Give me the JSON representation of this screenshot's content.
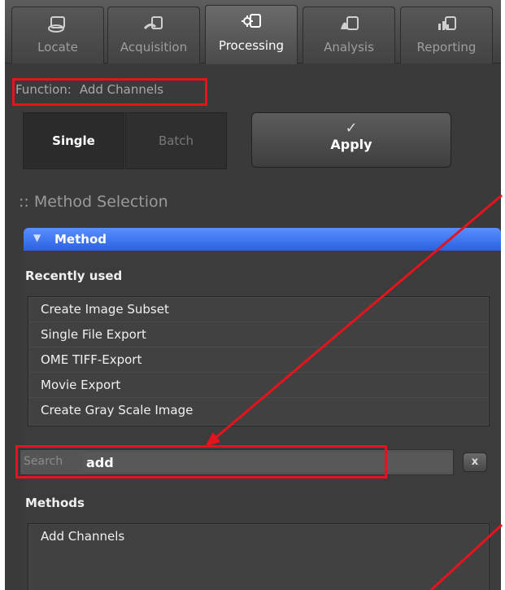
{
  "tabs": [
    {
      "label": "Locate",
      "icon": "locate-icon",
      "active": false
    },
    {
      "label": "Acquisition",
      "icon": "acquisition-icon",
      "active": false
    },
    {
      "label": "Processing",
      "icon": "processing-icon",
      "active": true
    },
    {
      "label": "Analysis",
      "icon": "analysis-icon",
      "active": false
    },
    {
      "label": "Reporting",
      "icon": "reporting-icon",
      "active": false
    }
  ],
  "function": {
    "label": "Function:",
    "value": "Add Channels"
  },
  "mode": {
    "single": "Single",
    "batch": "Batch",
    "selected": "Single"
  },
  "apply": {
    "label": "Apply",
    "icon": "checkmark-icon"
  },
  "section_title": ":: Method Selection",
  "method": {
    "header": "Method",
    "recent_label": "Recently used",
    "recent": [
      "Create Image Subset",
      "Single File Export",
      "OME TIFF-Export",
      "Movie Export",
      "Create Gray Scale Image"
    ],
    "search_label": "Search",
    "search_value": "add",
    "clear_label": "x",
    "methods_label": "Methods",
    "methods": [
      "Add Channels"
    ]
  },
  "colors": {
    "accent": "#3a72f0",
    "annotation": "#e5131c",
    "panel": "#3a3a3a"
  }
}
